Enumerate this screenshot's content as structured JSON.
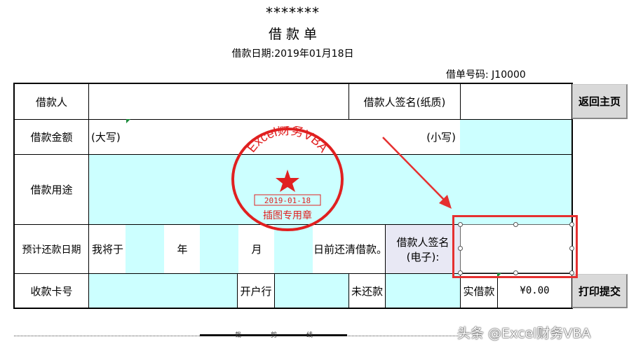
{
  "header": {
    "stars": "*******",
    "title": "借 款 单",
    "date_line": "借款日期:2019年01月18日",
    "doc_no": "借单号码: J10000"
  },
  "table": {
    "borrower_label": "借款人",
    "borrower_value": "",
    "paper_sign_label": "借款人签名(纸质)",
    "amount_label": "借款金额",
    "amount_upper": "(大写)",
    "amount_lower": "(小写)",
    "purpose_label": "借款用途",
    "repay_label": "预计还款日期",
    "repay_prefix": "我将于",
    "year": "年",
    "month": "月",
    "repay_suffix": "日前还清借款。",
    "esign_label": "借款人签名",
    "esign_sub": "(电子):",
    "card_label": "收款卡号",
    "bank_label": "开户行",
    "unpaid_label": "未还款",
    "actual_label": "实借款",
    "actual_value": "¥0.00"
  },
  "buttons": {
    "home": "返回主页",
    "print": "打印提交"
  },
  "seal": {
    "arc_text": "Excel财务VBA",
    "date": "2019-01-18",
    "caption": "插图专用章",
    "color": "#e02020"
  },
  "footer": {
    "cut_line": "裁　　剪　　线",
    "watermark": "头条 @Excel财务VBA"
  },
  "colors": {
    "cyan": "#ccffff",
    "highlight": "#e53030"
  }
}
